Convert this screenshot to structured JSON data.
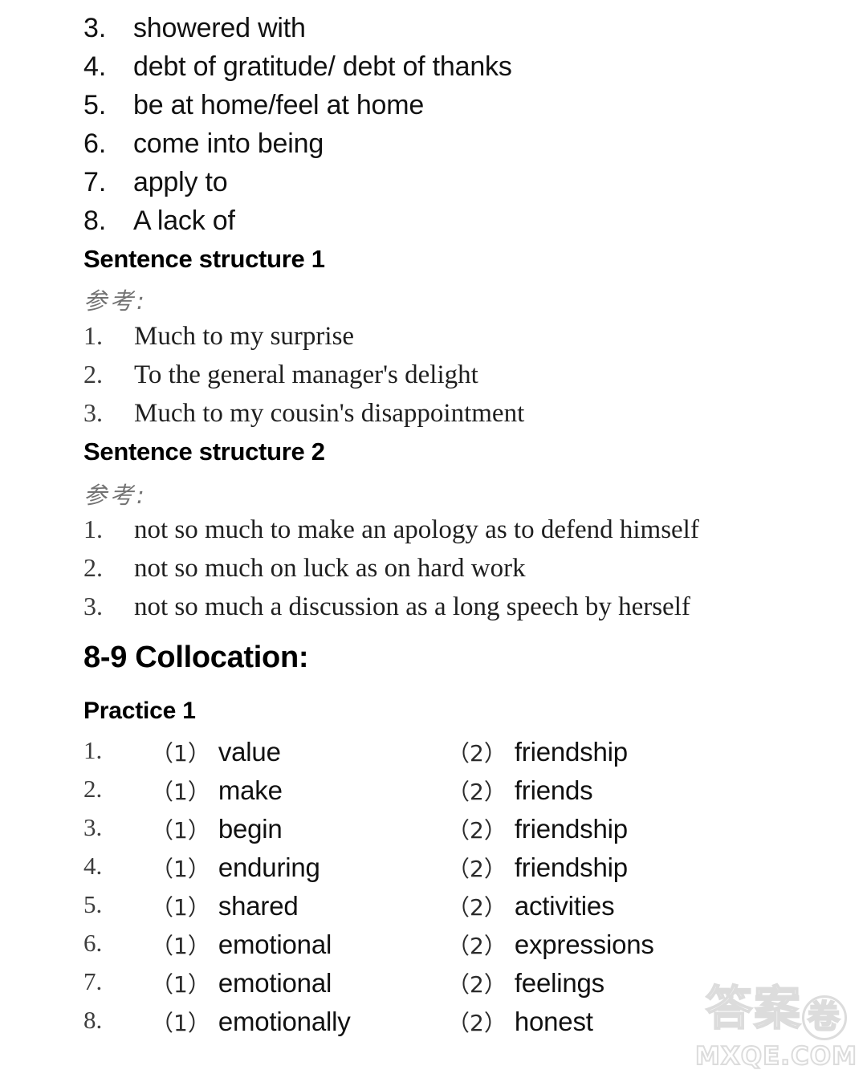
{
  "document": {
    "background_color": "#ffffff",
    "text_color": "#111111"
  },
  "top_answer_list": {
    "items": [
      {
        "num": "3.",
        "text": "showered with"
      },
      {
        "num": "4.",
        "text": "debt of gratitude/ debt of thanks"
      },
      {
        "num": "5.",
        "text": "be at home/feel at home"
      },
      {
        "num": "6.",
        "text": "come into being"
      },
      {
        "num": "7.",
        "text": "apply to"
      },
      {
        "num": "8.",
        "text": "A lack of"
      }
    ]
  },
  "sentence_structure_1": {
    "heading": "Sentence structure 1",
    "reference_label": "参考:",
    "items": [
      {
        "num": "1.",
        "text": "Much to my surprise"
      },
      {
        "num": "2.",
        "text": "To the general manager's delight"
      },
      {
        "num": "3.",
        "text": "Much to my cousin's disappointment"
      }
    ]
  },
  "sentence_structure_2": {
    "heading": "Sentence structure 2",
    "reference_label": "参考:",
    "items": [
      {
        "num": "1.",
        "text": "not so much to make an apology as to defend himself"
      },
      {
        "num": "2.",
        "text": "not so much on luck as on hard work"
      },
      {
        "num": "3.",
        "text": "not so much a discussion as a long speech by herself"
      }
    ]
  },
  "collocation_section": {
    "heading": "8-9 Collocation:",
    "practice_heading": "Practice 1",
    "rows": [
      {
        "num": "1.",
        "p1": "（1）",
        "w1": "value",
        "p2": "（2）",
        "w2": "friendship"
      },
      {
        "num": "2.",
        "p1": "（1）",
        "w1": "make",
        "p2": "（2）",
        "w2": "friends"
      },
      {
        "num": "3.",
        "p1": "（1）",
        "w1": "begin",
        "p2": "（2）",
        "w2": "friendship"
      },
      {
        "num": "4.",
        "p1": "（1）",
        "w1": "enduring",
        "p2": "（2）",
        "w2": "friendship"
      },
      {
        "num": "5.",
        "p1": "（1）",
        "w1": "shared",
        "p2": "（2）",
        "w2": "activities"
      },
      {
        "num": "6.",
        "p1": "（1）",
        "w1": "emotional",
        "p2": "（2）",
        "w2": "expressions"
      },
      {
        "num": "7.",
        "p1": "（1）",
        "w1": "emotional",
        "p2": "（2）",
        "w2": "feelings"
      },
      {
        "num": "8.",
        "p1": "（1）",
        "w1": "emotionally",
        "p2": "（2）",
        "w2": "honest"
      }
    ]
  },
  "watermark": {
    "cn_text_1": "答案",
    "cn_text_2": "卷",
    "url": "MXQE.COM",
    "color": "#dcdcdc"
  }
}
